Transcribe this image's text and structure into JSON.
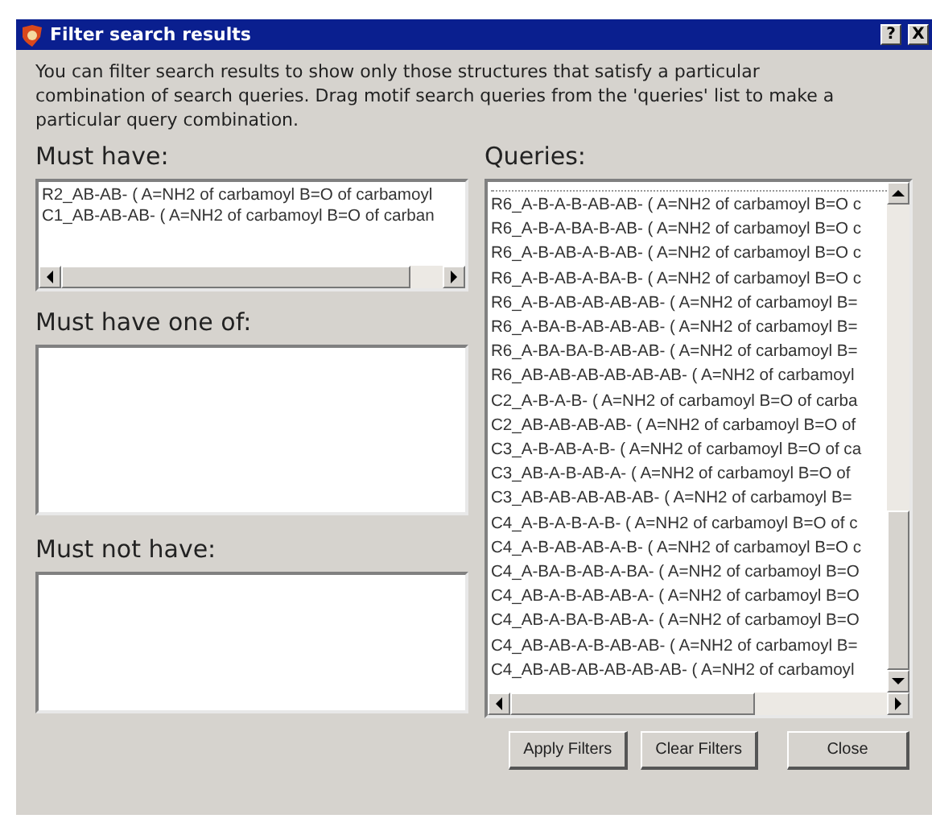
{
  "window": {
    "title": "Filter search results",
    "title_buttons": [
      "?",
      "X"
    ]
  },
  "intro": "You can filter search results to show only those structures that satisfy a particular combination of search queries. Drag motif search queries from the 'queries' list to make a particular query combination.",
  "must_have": {
    "label": "Must have:",
    "items": [
      "R2_AB-AB- ( A=NH2 of carbamoyl B=O of carbamoyl",
      "C1_AB-AB-AB- ( A=NH2 of carbamoyl B=O of carban"
    ]
  },
  "must_have_one_of": {
    "label": "Must have one of:"
  },
  "must_not_have": {
    "label": "Must not have:"
  },
  "queries": {
    "label": "Queries:",
    "items": [
      "R6_A-B-A-B-AB-AB- ( A=NH2 of carbamoyl B=O c",
      "R6_A-B-A-BA-B-AB- ( A=NH2 of carbamoyl B=O c",
      "R6_A-B-AB-A-B-AB- ( A=NH2 of carbamoyl B=O c",
      "R6_A-B-AB-A-BA-B- ( A=NH2 of carbamoyl B=O c",
      "R6_A-B-AB-AB-AB-AB- ( A=NH2 of carbamoyl B=",
      "R6_A-BA-B-AB-AB-AB- ( A=NH2 of carbamoyl B=",
      "R6_A-BA-BA-B-AB-AB- ( A=NH2 of carbamoyl B=",
      "R6_AB-AB-AB-AB-AB-AB- ( A=NH2 of carbamoyl",
      "C2_A-B-A-B- ( A=NH2 of carbamoyl B=O of carba",
      "C2_AB-AB-AB-AB- ( A=NH2 of carbamoyl B=O of",
      "C3_A-B-AB-A-B- ( A=NH2 of carbamoyl B=O of ca",
      "C3_AB-A-B-AB-A- ( A=NH2 of carbamoyl B=O of",
      "C3_AB-AB-AB-AB-AB- ( A=NH2 of carbamoyl B=",
      "C4_A-B-A-B-A-B- ( A=NH2 of carbamoyl B=O of c",
      "C4_A-B-AB-AB-A-B- ( A=NH2 of carbamoyl B=O c",
      "C4_A-BA-B-AB-A-BA- ( A=NH2 of carbamoyl B=O",
      "C4_AB-A-B-AB-AB-A- ( A=NH2 of carbamoyl B=O",
      "C4_AB-A-BA-B-AB-A- ( A=NH2 of carbamoyl B=O",
      "C4_AB-AB-A-B-AB-AB- ( A=NH2 of carbamoyl B=",
      "C4_AB-AB-AB-AB-AB-AB- ( A=NH2 of carbamoyl"
    ]
  },
  "buttons": [
    "Apply Filters",
    "Clear Filters",
    "Close"
  ]
}
